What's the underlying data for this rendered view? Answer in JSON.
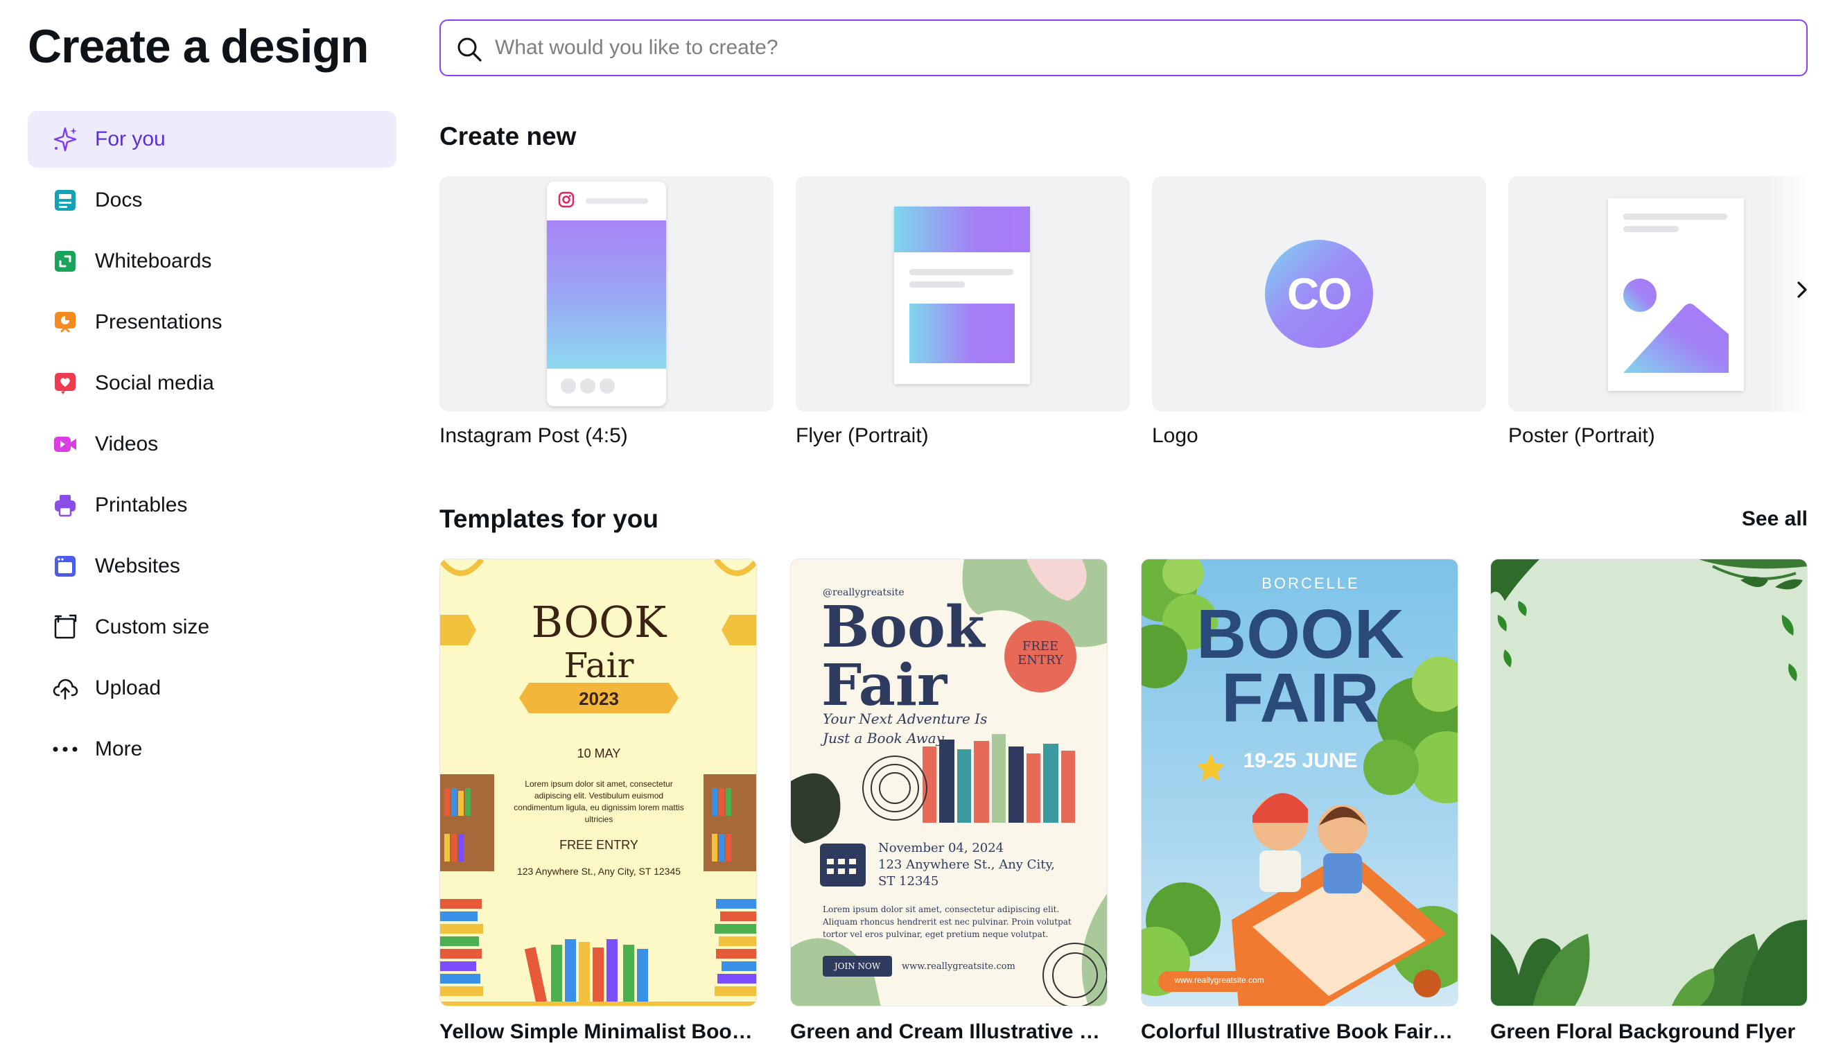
{
  "page": {
    "title": "Create a design"
  },
  "search": {
    "placeholder": "What would you like to create?"
  },
  "sidebar": {
    "items": [
      {
        "label": "For you",
        "icon": "sparkle-icon",
        "active": true
      },
      {
        "label": "Docs",
        "icon": "docs-icon"
      },
      {
        "label": "Whiteboards",
        "icon": "whiteboard-icon"
      },
      {
        "label": "Presentations",
        "icon": "presentation-icon"
      },
      {
        "label": "Social media",
        "icon": "heart-icon"
      },
      {
        "label": "Videos",
        "icon": "video-icon"
      },
      {
        "label": "Printables",
        "icon": "printer-icon"
      },
      {
        "label": "Websites",
        "icon": "website-icon"
      },
      {
        "label": "Custom size",
        "icon": "custom-size-icon"
      },
      {
        "label": "Upload",
        "icon": "cloud-upload-icon"
      },
      {
        "label": "More",
        "icon": "more-dots-icon"
      }
    ]
  },
  "create_new": {
    "title": "Create new",
    "cards": [
      {
        "label": "Instagram Post (4:5)"
      },
      {
        "label": "Flyer (Portrait)"
      },
      {
        "label": "Logo",
        "logo_text": "CO"
      },
      {
        "label": "Poster (Portrait)"
      }
    ]
  },
  "templates": {
    "title": "Templates for you",
    "see_all": "See all",
    "items": [
      {
        "label": "Yellow Simple Minimalist Book ...",
        "t1": "BOOK",
        "t2": "Fair",
        "year": "2023",
        "date": "10 MAY",
        "body": "Lorem ipsum dolor sit amet, consectetur adipiscing elit. Vestibulum euismod condimentum ligula, eu dignissim lorem mattis ultricies",
        "entry": "FREE ENTRY",
        "address": "123 Anywhere St., Any City, ST 12345"
      },
      {
        "label": "Green and Cream Illustrative Bo...",
        "handle": "@reallygreatsite",
        "t1": "Book",
        "t2": "Fair",
        "badge": "FREE ENTRY",
        "tagline1": "Your Next Adventure Is",
        "tagline2": "Just a Book Away",
        "date": "November 04, 2024",
        "addr1": "123 Anywhere St., Any City,",
        "addr2": "ST 12345",
        "body": "Lorem ipsum dolor sit amet, consectetur adipiscing elit. Aliquam rhoncus hendrerit est nec pulvinar. Proin volutpat tortor vel eros pulvinar, eget pretium neque volutpat.",
        "button": "JOIN NOW",
        "site": "www.reallygreatsite.com"
      },
      {
        "label": "Colorful Illustrative Book Fair Fl...",
        "brand": "BORCELLE",
        "t1": "BOOK",
        "t2": "FAIR",
        "date": "19-25 JUNE",
        "site": "www.reallygreatsite.com"
      },
      {
        "label": "Green Floral Background Flyer"
      }
    ]
  },
  "colors": {
    "accent": "#8b3dff",
    "active_bg": "#eeebfd",
    "active_text": "#5b2fd8"
  }
}
